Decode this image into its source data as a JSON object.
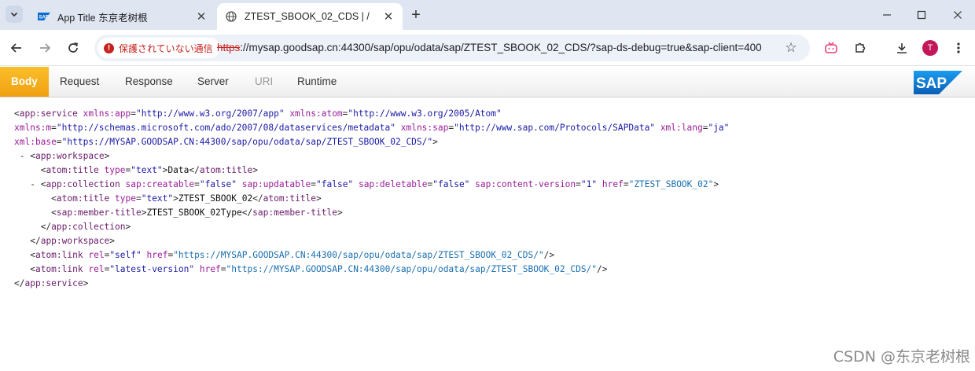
{
  "browser": {
    "tabs": [
      {
        "title": "App Title 东京老树根",
        "active": false
      },
      {
        "title": "ZTEST_SBOOK_02_CDS | /",
        "active": true
      }
    ],
    "security_label": "保護されていない通信",
    "url_scheme": "https",
    "url_rest": "://mysap.goodsap.cn:44300/sap/opu/odata/sap/ZTEST_SBOOK_02_CDS/?sap-ds-debug=true&sap-client=400",
    "profile_initial": "T"
  },
  "sap_debug": {
    "tabs": [
      "Body",
      "Request",
      "Response",
      "Server",
      "URI",
      "Runtime"
    ],
    "active_tab": "Body",
    "disabled_tab": "URI",
    "logo_text": "SAP"
  },
  "xml": {
    "root_tag": "app:service",
    "xmlns_app_attr": "xmlns:app",
    "xmlns_app": "\"http://www.w3.org/2007/app\"",
    "xmlns_atom_attr": "xmlns:atom",
    "xmlns_atom": "\"http://www.w3.org/2005/Atom\"",
    "xmlns_m_attr": "xmlns:m",
    "xmlns_m": "\"http://schemas.microsoft.com/ado/2007/08/dataservices/metadata\"",
    "xmlns_sap_attr": "xmlns:sap",
    "xmlns_sap": "\"http://www.sap.com/Protocols/SAPData\"",
    "xml_lang_attr": "xml:lang",
    "xml_lang": "\"ja\"",
    "xml_base_attr": "xml:base",
    "xml_base": "\"https://MYSAP.GOODSAP.CN:44300/sap/opu/odata/sap/ZTEST_SBOOK_02_CDS/\"",
    "workspace_tag": "app:workspace",
    "atom_title_tag": "atom:title",
    "type_attr": "type",
    "type_text": "\"text\"",
    "workspace_title": "Data",
    "collection_tag": "app:collection",
    "creatable_attr": "sap:creatable",
    "creatable": "\"false\"",
    "updatable_attr": "sap:updatable",
    "updatable": "\"false\"",
    "deletable_attr": "sap:deletable",
    "deletable": "\"false\"",
    "content_version_attr": "sap:content-version",
    "content_version": "\"1\"",
    "href_attr": "href",
    "collection_href": "\"ZTEST_SBOOK_02\"",
    "collection_title": "ZTEST_SBOOK_02",
    "member_title_tag": "sap:member-title",
    "member_title": "ZTEST_SBOOK_02Type",
    "atom_link_tag": "atom:link",
    "rel_attr": "rel",
    "rel_self": "\"self\"",
    "link_self_href": "\"https://MYSAP.GOODSAP.CN:44300/sap/opu/odata/sap/ZTEST_SBOOK_02_CDS/\"",
    "rel_latest": "\"latest-version\"",
    "link_latest_href": "\"https://MYSAP.GOODSAP.CN:44300/sap/opu/odata/sap/ZTEST_SBOOK_02_CDS/\"",
    "toggle_symbol": "-"
  },
  "watermark": "CSDN @东京老树根",
  "colors": {
    "sap_tab_active": "#f0a010",
    "sap_logo_blue": "#0a6ed1",
    "security_red": "#c5221f",
    "avatar": "#c2185b"
  }
}
